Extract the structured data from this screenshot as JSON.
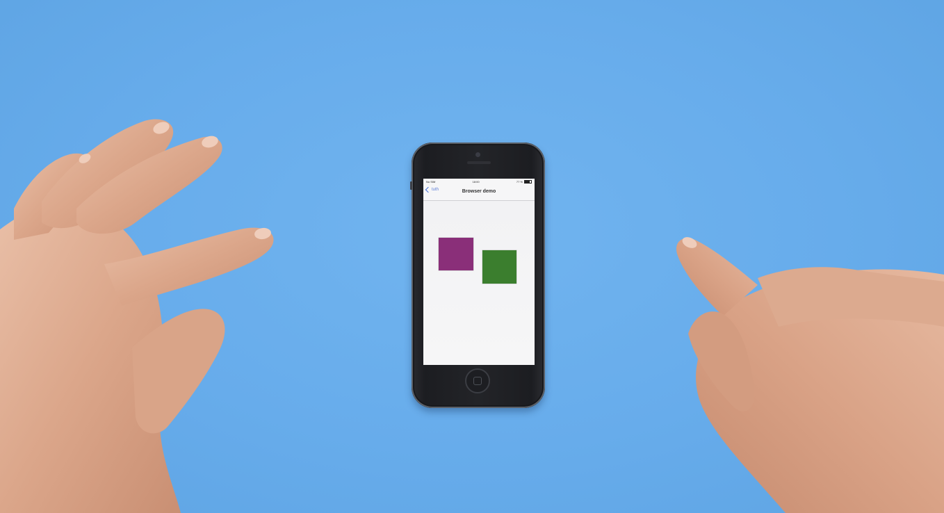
{
  "phone": {
    "status_bar": {
      "carrier": "No SIM",
      "time": "18:00",
      "battery": "77 %"
    },
    "nav": {
      "back_label": "tuth",
      "title": "Browser demo"
    },
    "content": {
      "square_purple_color": "#8a2f79",
      "square_green_color": "#3b7e2e"
    }
  }
}
